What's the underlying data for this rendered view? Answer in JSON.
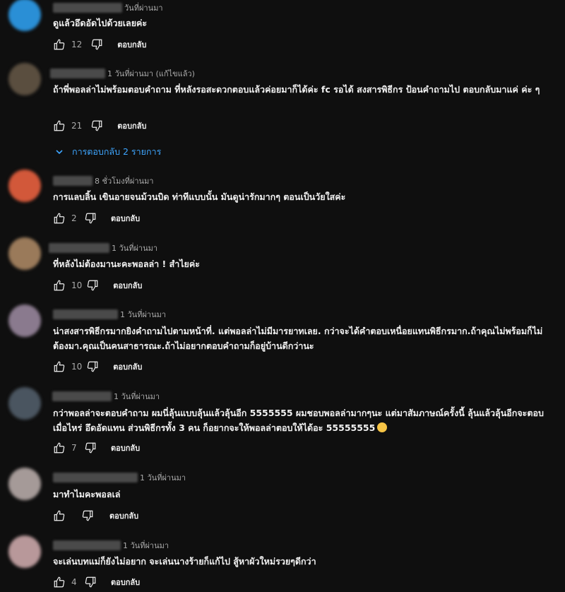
{
  "comments": [
    {
      "time": "วันที่ผ่านมา",
      "text": "ดูแล้วอึดอัดไปด้วยเลยค่ะ",
      "likes": "12",
      "reply": "ตอบกลับ"
    },
    {
      "time": "1 วันที่ผ่านมา (แก้ไขแล้ว)",
      "text": "ถ้าพี่พอลล่าไม่พร้อมตอบคำถาม ที่หลังรอสะดวกตอบแล้วค่อยมาก็ได้ค่ะ fc รอได้ สงสารพิธีกร ป้อนคำถามไป ตอบกลับมาแค่ ค่ะ ๆ",
      "likes": "21",
      "reply": "ตอบกลับ",
      "replies_link": "การตอบกลับ 2 รายการ"
    },
    {
      "time": "8 ชั่วโมงที่ผ่านมา",
      "text": "การแลบลิ้น เขินอายจนม้วนบิด ท่าทีแบบนั้น มันดูน่ารักมากๆ ตอนเป็นวัยใสค่ะ",
      "likes": "2",
      "reply": "ตอบกลับ"
    },
    {
      "time": "1 วันที่ผ่านมา",
      "text": "ที่หลังไม่ต้องมานะคะพอลล่า ! สำไยค่ะ",
      "likes": "10",
      "reply": "ตอบกลับ"
    },
    {
      "time": "1 วันที่ผ่านมา",
      "text": "น่าสงสารพิธีกรมากยิงคำถามไปตามหน้าที่. แต่พอลล่าไม่มีมารยาทเลย. กว่าจะได้คำตอบเหนื่อยแทนพิธีกรมาก.ถ้าคุณไม่พร้อมก็ไม่ต้องมา.คุณเป็นคนสาธารณะ.ถ้าไม่อยากตอบคำถามก็อยู่บ้านดีกว่านะ",
      "likes": "10",
      "reply": "ตอบกลับ"
    },
    {
      "time": "1 วันที่ผ่านมา",
      "text": "กว่าพอลล่าจะตอบคำถาม ผมนี่ลุ้นแบบลุ้นแล้วลุ้นอีก 5555555 ผมชอบพอลล่ามากๆนะ แต่มาสัมภาษณ์ครั้งนี้ ลุ้นแล้วลุ้นอีกจะตอบเมื่อไหร่ อึดอัดแทน ส่วนพิธีกรทั้ง 3 คน ก็อยากจะให้พอลล่าตอบให้ได้อะ 55555555",
      "likes": "7",
      "reply": "ตอบกลับ"
    },
    {
      "time": "1 วันที่ผ่านมา",
      "text": "มาทำไมคะพอลเล่",
      "likes": "",
      "reply": "ตอบกลับ"
    },
    {
      "time": "1 วันที่ผ่านมา",
      "text": "จะเล่นบทแม่ก็ยังไม่อยาก จะเล่นนางร้ายก็แก้ไป สู้หาผัวใหม่รวยๆดีกว่า",
      "likes": "4",
      "reply": "ตอบกลับ"
    }
  ],
  "avatar_colors": [
    "#2a8fd6",
    "#5a4e3f",
    "#d2583a",
    "#9a7a5a",
    "#8a7a8e",
    "#4a5560",
    "#a59a98",
    "#b8989a"
  ],
  "icons": {
    "like": "thumbs-up-icon",
    "dislike": "thumbs-down-icon",
    "expand": "chevron-down-icon",
    "emoji": "grinning-sweat-emoji"
  }
}
